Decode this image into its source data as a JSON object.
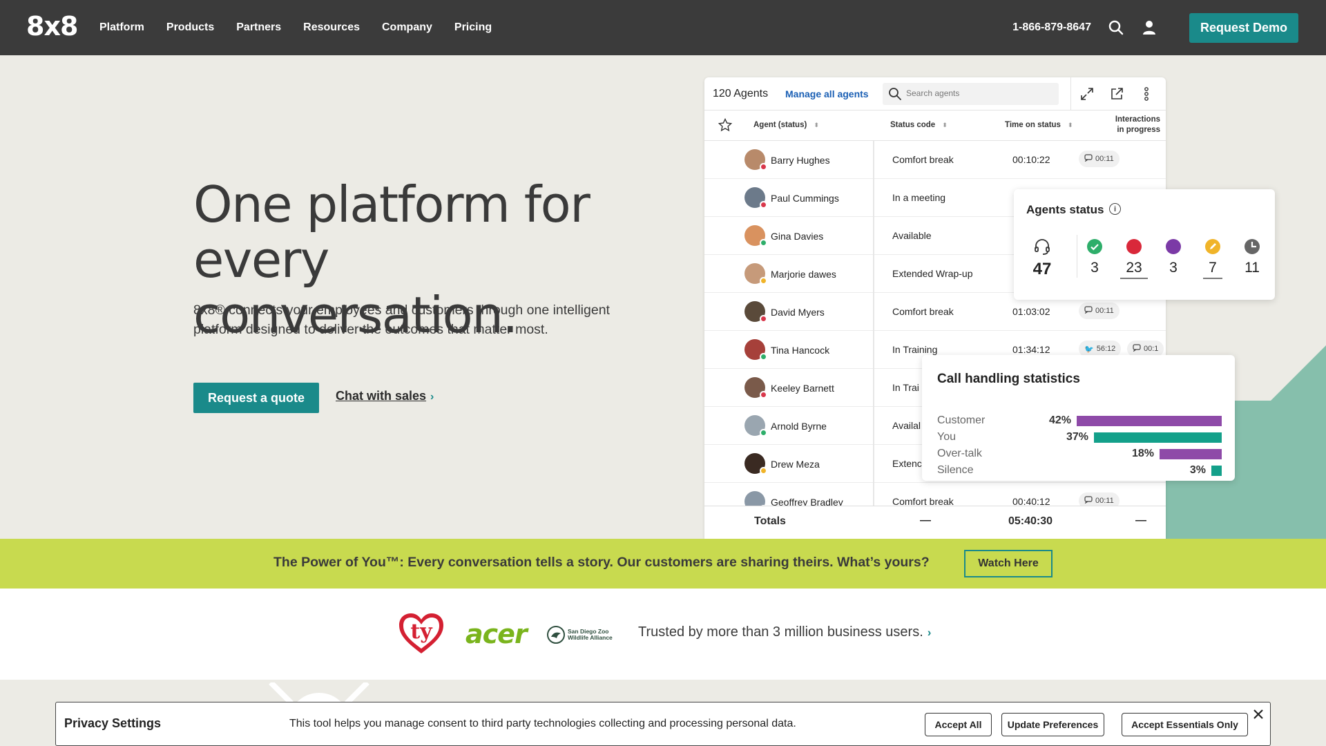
{
  "nav": {
    "logo": "8x8",
    "items": [
      "Platform",
      "Products",
      "Partners",
      "Resources",
      "Company",
      "Pricing"
    ],
    "phone": "1-866-879-8647",
    "demo_label": "Request Demo"
  },
  "hero": {
    "title": "One platform for every conversation.",
    "subtitle": "8x8® connects your employees and customers through one intelligent platform designed to deliver the outcomes that matter most.",
    "primary_cta": "Request a quote",
    "secondary_cta": "Chat with sales"
  },
  "agents_panel": {
    "count": "120 Agents",
    "manage_link": "Manage all agents",
    "search_placeholder": "Search agents",
    "columns": {
      "agent": "Agent (status)",
      "status_code": "Status code",
      "time_on_status": "Time on status",
      "interactions_line1": "Interactions",
      "interactions_line2": "in progress"
    },
    "rows": [
      {
        "name": "Barry Hughes",
        "status": "Comfort break",
        "time": "00:10:22",
        "chip": "00:11",
        "dot": "#d9374b",
        "avatar": "#b88a6a"
      },
      {
        "name": "Paul Cummings",
        "status": "In a meeting",
        "time": "",
        "chip": "",
        "dot": "#d9374b",
        "avatar": "#6c7a8a"
      },
      {
        "name": "Gina Davies",
        "status": "Available",
        "time": "",
        "chip": "",
        "dot": "#2eae6a",
        "avatar": "#d9925f"
      },
      {
        "name": "Marjorie dawes",
        "status": "Extended Wrap-up",
        "time": "",
        "chip": "",
        "dot": "#f0b429",
        "avatar": "#c69a7a"
      },
      {
        "name": "David Myers",
        "status": "Comfort break",
        "time": "01:03:02",
        "chip": "00:11",
        "dot": "#d9374b",
        "avatar": "#5a4a3a"
      },
      {
        "name": "Tina Hancock",
        "status": "In Training",
        "time": "01:34:12",
        "chip": "56:12",
        "dot": "#2eae6a",
        "avatar": "#a6403a"
      },
      {
        "name": "Keeley Barnett",
        "status": "In Trai",
        "time": "",
        "chip": "",
        "dot": "#d9374b",
        "avatar": "#7a5a4a"
      },
      {
        "name": "Arnold Byrne",
        "status": "Availal",
        "time": "",
        "chip": "",
        "dot": "#2eae6a",
        "avatar": "#9aa6b0"
      },
      {
        "name": "Drew Meza",
        "status": "Extenc",
        "time": "",
        "chip": "",
        "dot": "#f0b429",
        "avatar": "#3a2a22"
      },
      {
        "name": "Geoffrey Bradley",
        "status": "Comfort break",
        "time": "00:40:12",
        "chip": "00:11",
        "dot": "#d9374b",
        "avatar": "#8a98a6"
      }
    ],
    "extra_chip": "00:1",
    "totals_label": "Totals",
    "totals_dash": "—",
    "totals_time": "05:40:30"
  },
  "agents_status": {
    "title": "Agents status",
    "total": "47",
    "available": "3",
    "busy": "23",
    "wrap": "3",
    "break": "7",
    "away": "11",
    "colors": {
      "available": "#2eae6a",
      "busy": "#d9283a",
      "wrap": "#7b3aa6",
      "break": "#f0b429",
      "away": "#666666"
    }
  },
  "call_stats": {
    "title": "Call handling statistics",
    "rows": [
      {
        "label": "Customer",
        "pct": "42%",
        "value": 42,
        "color": "#8e4aa8"
      },
      {
        "label": "You",
        "pct": "37%",
        "value": 37,
        "color": "#13a08a"
      },
      {
        "label": "Over-talk",
        "pct": "18%",
        "value": 18,
        "color": "#8e4aa8"
      },
      {
        "label": "Silence",
        "pct": "3%",
        "value": 3,
        "color": "#13a08a"
      }
    ]
  },
  "banner": {
    "text": "The Power of You™: Every conversation tells a story. Our customers are sharing theirs. What’s yours?",
    "button": "Watch Here"
  },
  "trust": {
    "logo_ty": "ty",
    "logo_acer": "acer",
    "logo_zoo_1": "San Diego Zoo",
    "logo_zoo_2": "Wildlife Alliance",
    "text": "Trusted by more than 3 million business users."
  },
  "privacy": {
    "title": "Privacy Settings",
    "text": "This tool helps you manage consent to third party technologies collecting and processing personal data.",
    "accept_all": "Accept All",
    "update": "Update Preferences",
    "essentials": "Accept Essentials Only"
  }
}
